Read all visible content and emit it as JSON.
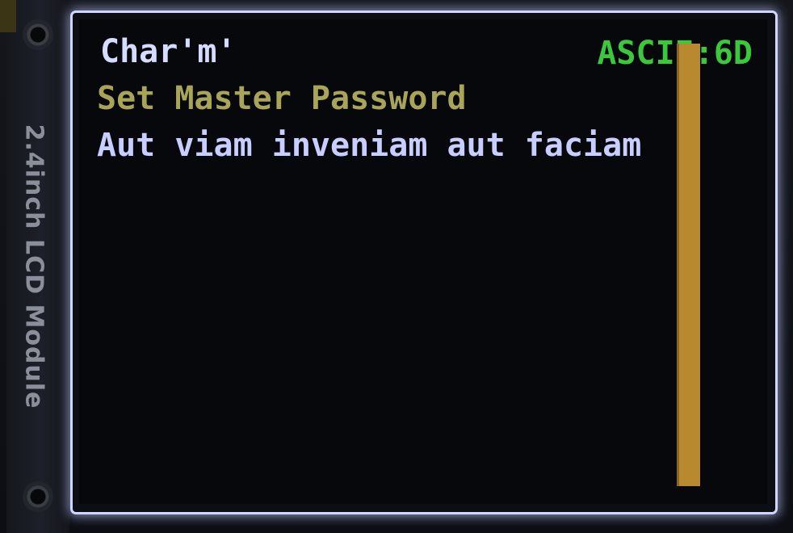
{
  "module": {
    "label": "2.4inch LCD Module"
  },
  "screen": {
    "char_title": "Char'm'",
    "ascii_label": "ASCII:6D",
    "heading": "Set Master Password",
    "body_text": "Aut viam inveniam aut faciam"
  },
  "colors": {
    "char_title": "#d6dcff",
    "ascii_label": "#3cc83c",
    "heading": "#a8a45a",
    "body_text": "#c8ceff",
    "scrollbar": "#b8892e"
  },
  "icons": {
    "mount_holes": "circle"
  }
}
